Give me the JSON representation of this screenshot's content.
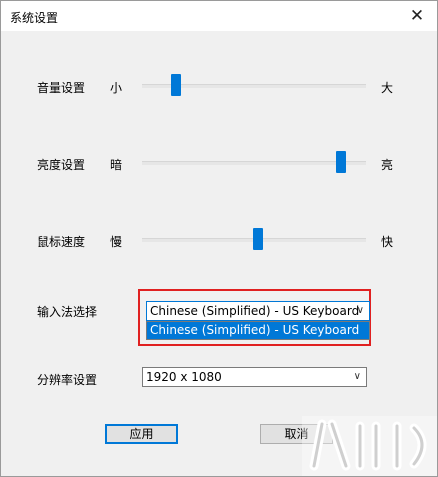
{
  "window": {
    "title": "系统设置"
  },
  "volume": {
    "label": "音量设置",
    "min_label": "小",
    "max_label": "大",
    "level": 0.15
  },
  "brightness": {
    "label": "亮度设置",
    "min_label": "暗",
    "max_label": "亮",
    "level": 0.89
  },
  "mouse_speed": {
    "label": "鼠标速度",
    "min_label": "慢",
    "max_label": "快",
    "level": 0.52
  },
  "input_method": {
    "label": "输入法选择",
    "selected": "Chinese (Simplified) - US Keyboard",
    "options": [
      "Chinese (Simplified) - US Keyboard"
    ]
  },
  "resolution": {
    "label": "分辨率设置",
    "selected": "1920 x 1080"
  },
  "buttons": {
    "apply": "应用",
    "cancel": "取消"
  },
  "icons": {
    "close": "close-icon",
    "dropdown": "chevron-down-icon"
  },
  "colors": {
    "accent": "#0078d7",
    "highlight": "#e02020"
  }
}
